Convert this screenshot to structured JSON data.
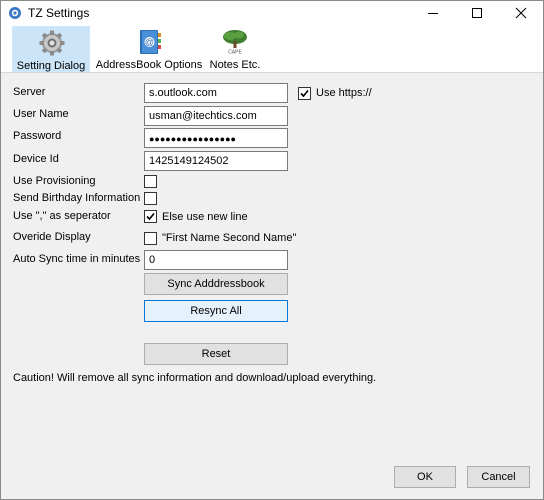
{
  "window": {
    "title": "TZ Settings",
    "icons": {
      "app": "app-icon",
      "minimize": "minimize-icon",
      "maximize": "maximize-icon",
      "close": "close-icon"
    }
  },
  "toolbar": {
    "tabs": [
      {
        "label": "Setting Dialog",
        "icon": "gear-icon",
        "active": true
      },
      {
        "label": "AddressBook Options",
        "icon": "address-book-icon",
        "active": false
      },
      {
        "label": "Notes Etc.",
        "icon": "tree-icon",
        "active": false
      }
    ]
  },
  "form": {
    "server": {
      "label": "Server",
      "value": "s.outlook.com"
    },
    "use_https": {
      "label": "Use https://",
      "checked": true
    },
    "username": {
      "label": "User Name",
      "value": "usman@itechtics.com"
    },
    "password": {
      "label": "Password",
      "value": "●●●●●●●●●●●●●●●●"
    },
    "device_id": {
      "label": "Device Id",
      "value": "1425149124502"
    },
    "use_provisioning": {
      "label": "Use Provisioning",
      "checked": false
    },
    "send_birthday": {
      "label": "Send Birthday Information",
      "checked": false
    },
    "separator": {
      "label": "Use \",\" as seperator",
      "checked": true,
      "option_label": "Else use new line"
    },
    "override_display": {
      "label": "Overide Display",
      "checked": false,
      "option_label": "\"First Name Second Name\""
    },
    "auto_sync": {
      "label": "Auto Sync time in minutes",
      "value": "0"
    }
  },
  "buttons": {
    "sync_addressbook": "Sync Adddressbook",
    "resync_all": "Resync All",
    "reset": "Reset",
    "ok": "OK",
    "cancel": "Cancel"
  },
  "caution": "Caution! Will remove all sync information and download/upload everything.",
  "colors": {
    "active_tab": "#cce4f7",
    "focus_border": "#0078d7",
    "window_bg": "#f0f0f0"
  }
}
